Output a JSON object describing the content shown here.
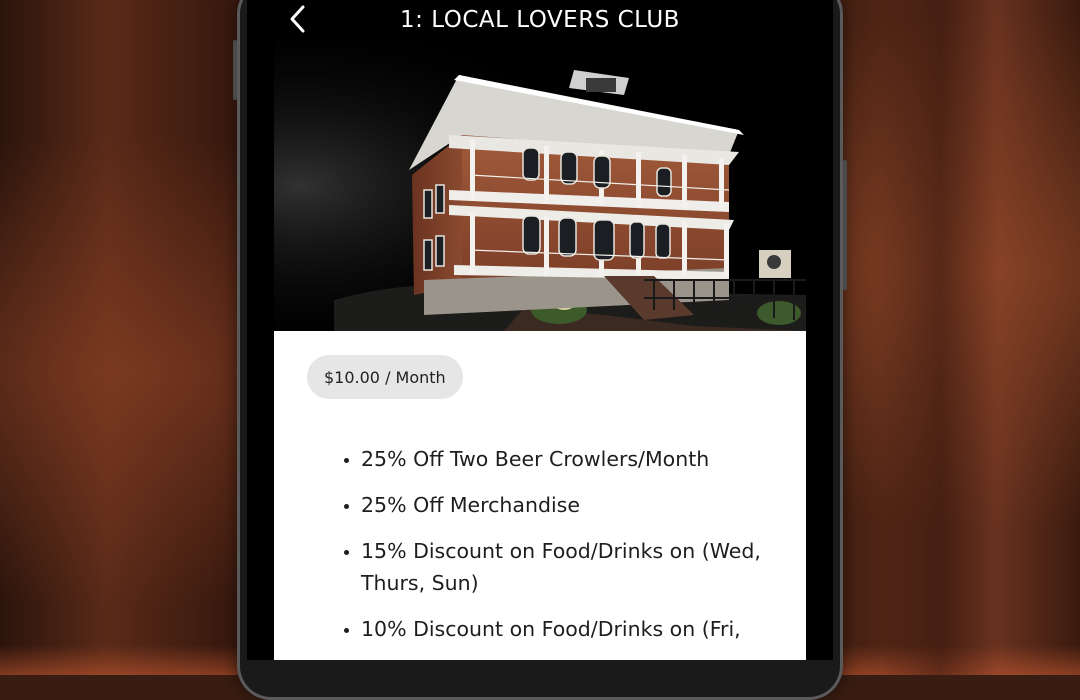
{
  "header": {
    "title": "1: LOCAL LOVERS CLUB",
    "back_icon": "chevron-left-icon"
  },
  "plan": {
    "price": "$10.00 / Month",
    "benefits": [
      "25% Off Two Beer Crowlers/Month",
      "25% Off Merchandise",
      "15% Discount on Food/Drinks on (Wed, Thurs, Sun)",
      "10% Discount on Food/Drinks on (Fri,"
    ]
  },
  "colors": {
    "app_background": "#000000",
    "card_background": "#ffffff",
    "pill_background": "#e6e6e6",
    "title_text": "#ffffff"
  }
}
